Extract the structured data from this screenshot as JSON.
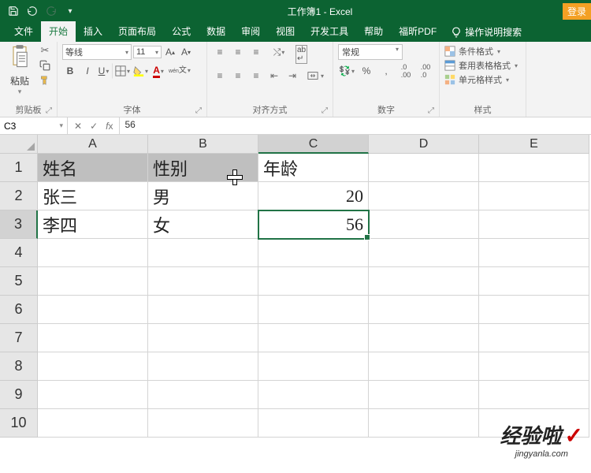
{
  "titlebar": {
    "title": "工作簿1 - Excel",
    "login": "登录"
  },
  "tabs": {
    "file": "文件",
    "home": "开始",
    "insert": "插入",
    "layout": "页面布局",
    "formulas": "公式",
    "data": "数据",
    "review": "审阅",
    "view": "视图",
    "dev": "开发工具",
    "help": "帮助",
    "foxit": "福昕PDF",
    "tell": "操作说明搜索"
  },
  "ribbon": {
    "clipboard": {
      "paste": "粘贴",
      "label": "剪贴板"
    },
    "font": {
      "name": "等线",
      "size": "11",
      "label": "字体",
      "ruby": "wén"
    },
    "align": {
      "wrap": "ab",
      "merge": "",
      "label": "对齐方式"
    },
    "number": {
      "format": "常规",
      "label": "数字"
    },
    "styles": {
      "cond": "条件格式",
      "table": "套用表格格式",
      "cell": "单元格样式",
      "label": "样式"
    }
  },
  "namebox": "C3",
  "formula": "56",
  "columns": [
    "A",
    "B",
    "C",
    "D",
    "E"
  ],
  "rows": [
    "1",
    "2",
    "3",
    "4",
    "5",
    "6",
    "7",
    "8",
    "9",
    "10"
  ],
  "cells": {
    "A1": "姓名",
    "B1": "性别",
    "C1": "年龄",
    "A2": "张三",
    "B2": "男",
    "C2": "20",
    "A3": "李四",
    "B3": "女",
    "C3": "56"
  },
  "watermark": {
    "text": "经验啦",
    "url": "jingyanla.com"
  }
}
